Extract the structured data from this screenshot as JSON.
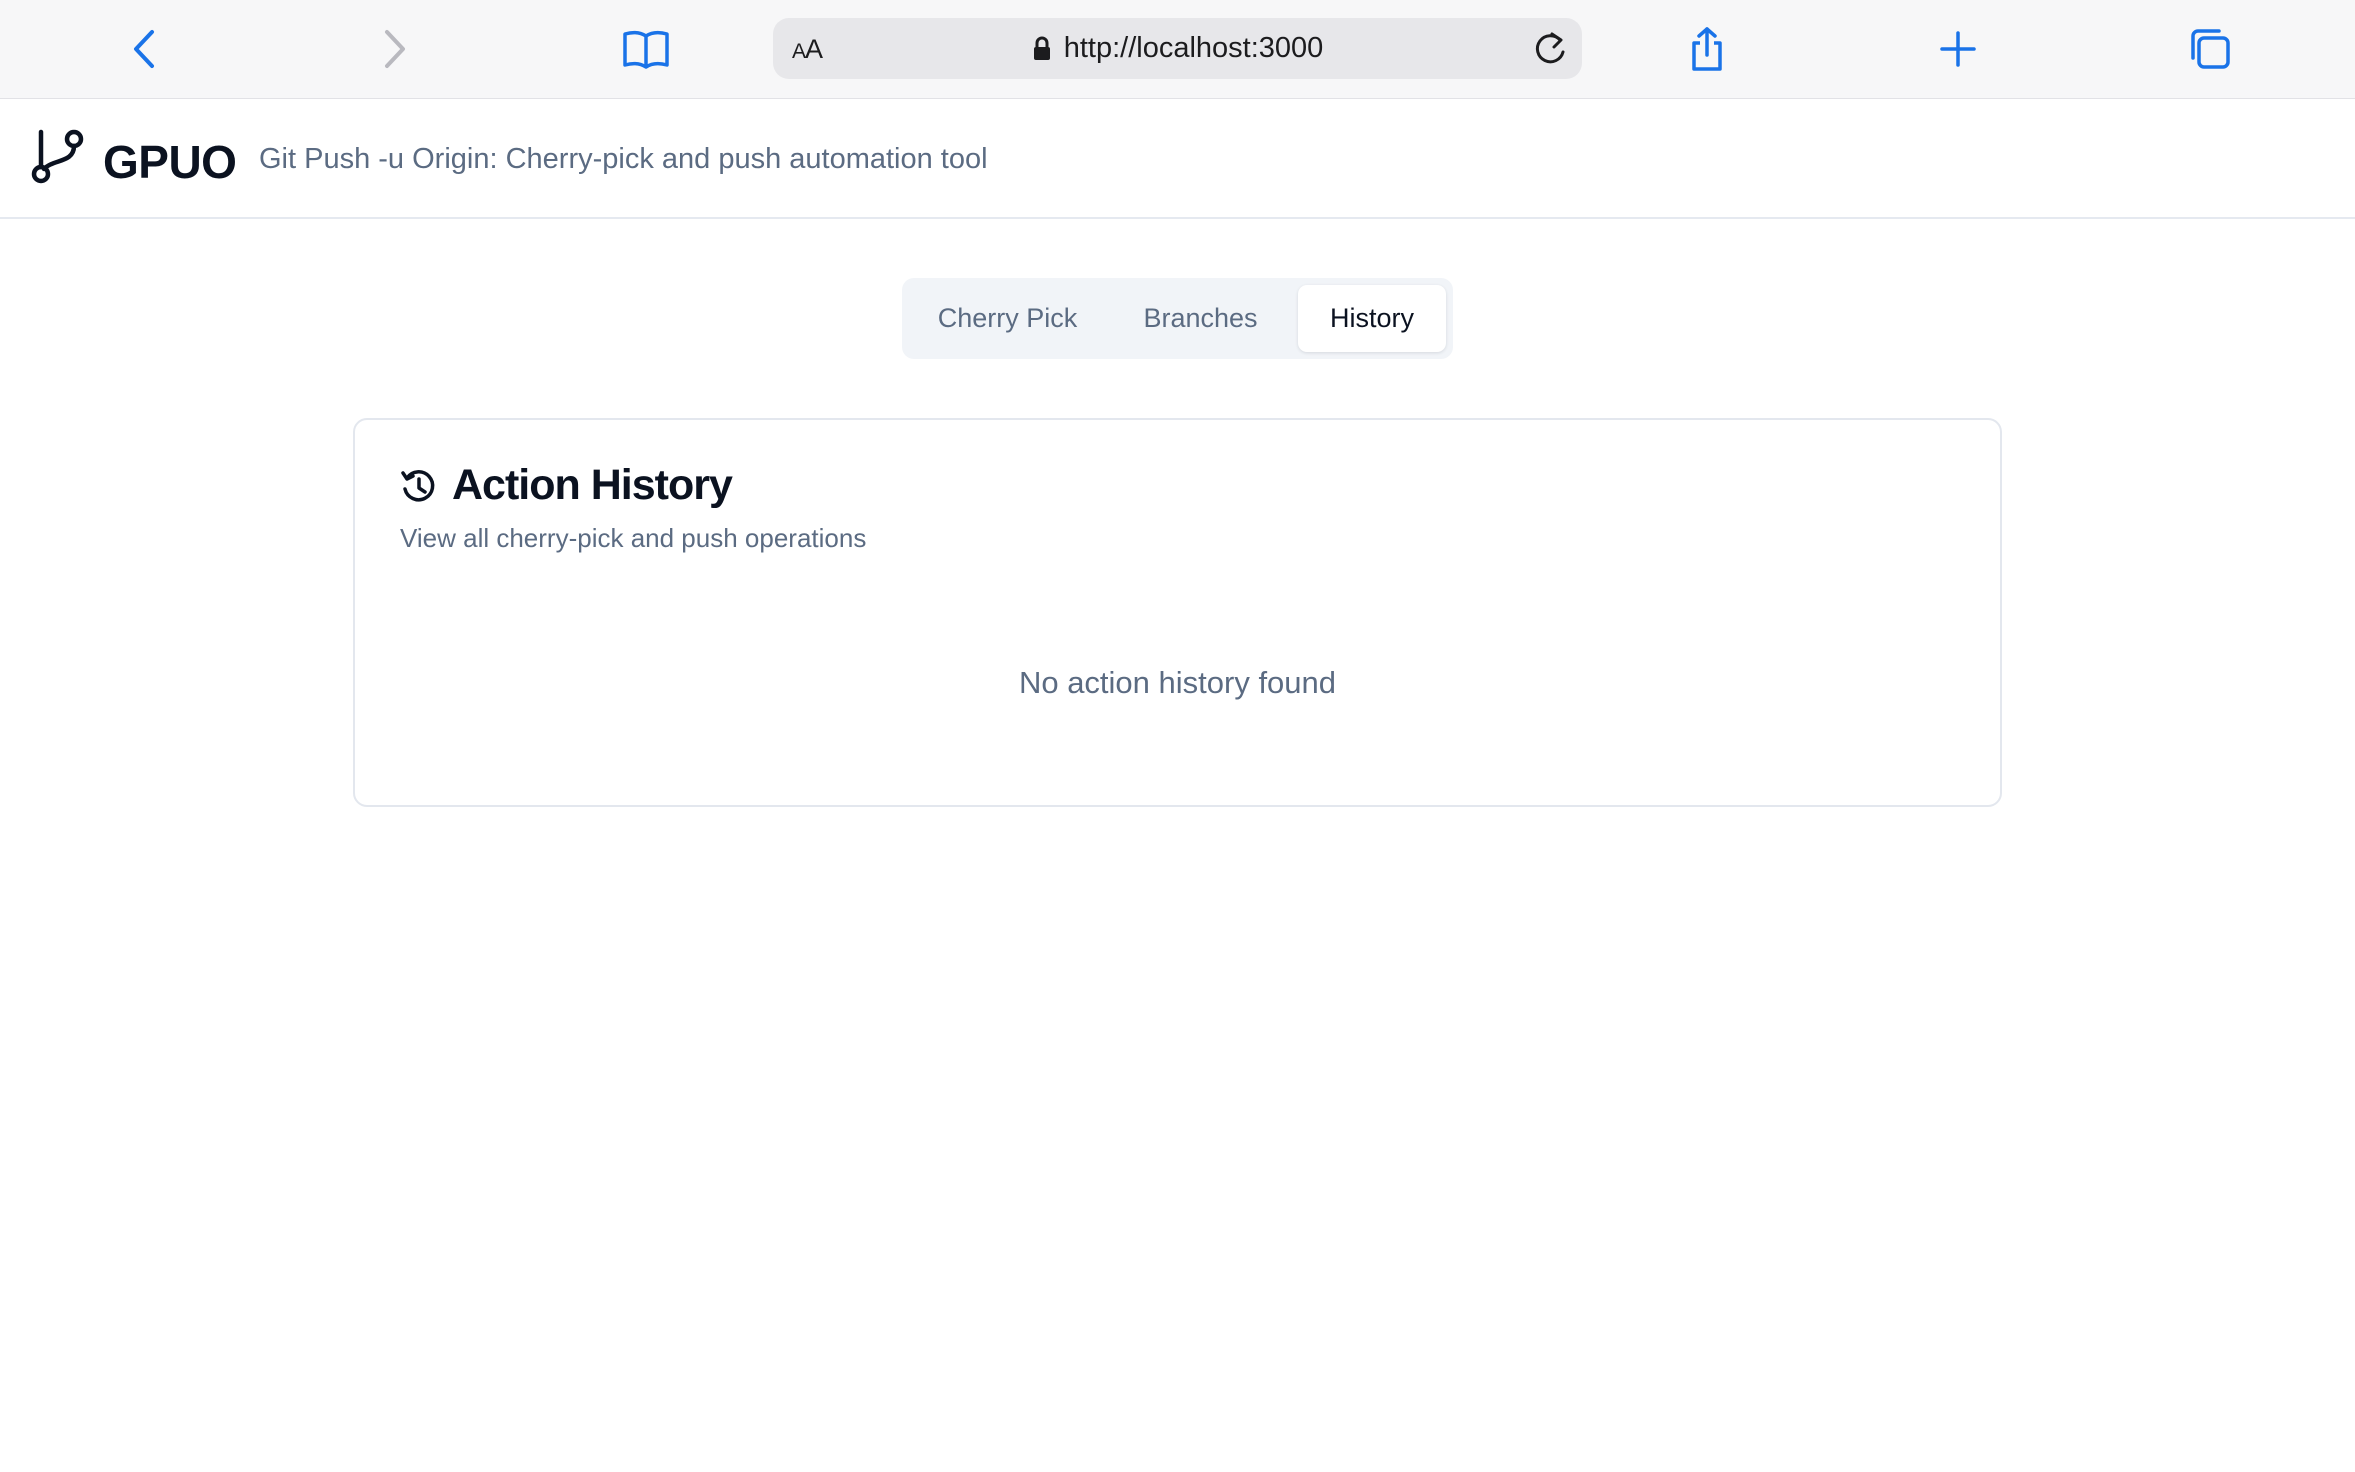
{
  "browser": {
    "aa_label_small": "A",
    "aa_label_large": "A",
    "url": "http://localhost:3000",
    "accent": "#1a73e8"
  },
  "app": {
    "title": "GPUO",
    "subtitle": "Git Push -u Origin: Cherry-pick and push automation tool",
    "logo_icon": "git-branch-icon"
  },
  "tabs": [
    {
      "label": "Cherry Pick",
      "active": false
    },
    {
      "label": "Branches",
      "active": false
    },
    {
      "label": "History",
      "active": true
    }
  ],
  "history_card": {
    "icon": "history-icon",
    "title": "Action History",
    "subtitle": "View all cherry-pick and push operations",
    "empty_message": "No action history found"
  }
}
